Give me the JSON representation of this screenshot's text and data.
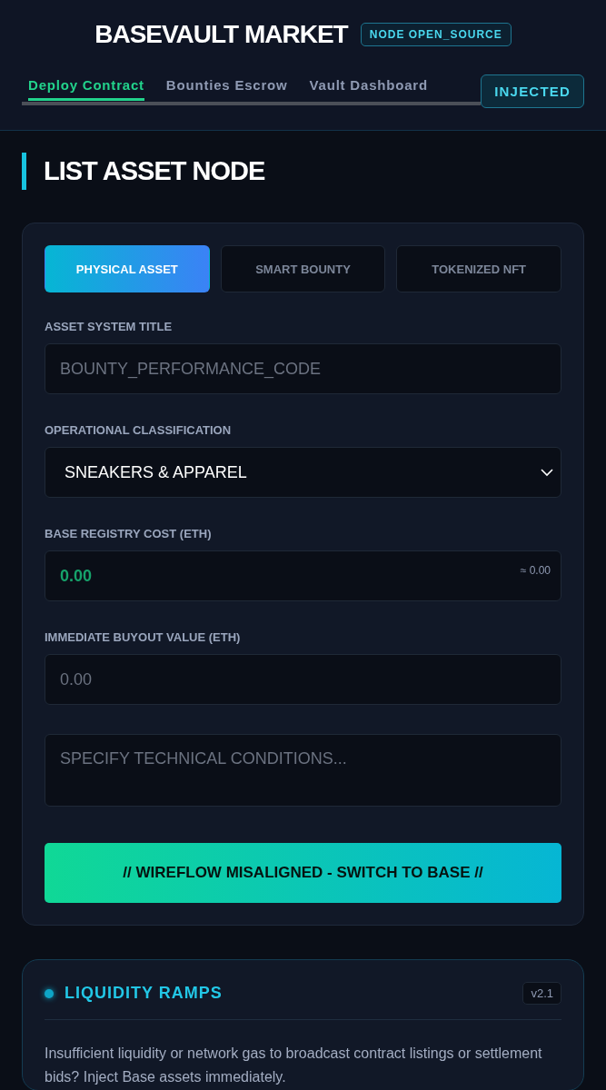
{
  "header": {
    "title": "BASEVAULT MARKET",
    "badge": "NODE OPEN_SOURCE"
  },
  "nav": {
    "tabs": [
      {
        "label": "Deploy Contract",
        "selected": true
      },
      {
        "label": "Bounties Escrow",
        "selected": false
      },
      {
        "label": "Vault Dashboard",
        "selected": false
      }
    ],
    "status_button": "INJECTED"
  },
  "section_title": "LIST ASSET NODE",
  "form": {
    "asset_types": [
      {
        "label": "PHYSICAL ASSET",
        "selected": true
      },
      {
        "label": "SMART BOUNTY",
        "selected": false
      },
      {
        "label": "TOKENIZED NFT",
        "selected": false
      }
    ],
    "fields": [
      {
        "kind": "text",
        "label": "ASSET SYSTEM TITLE",
        "placeholder": "BOUNTY_PERFORMANCE_CODE"
      },
      {
        "kind": "select",
        "label": "OPERATIONAL CLASSIFICATION",
        "value": "SNEAKERS & APPAREL"
      },
      {
        "kind": "price",
        "label": "BASE REGISTRY COST (ETH)",
        "value": "0.00",
        "hint": "≈ 0.00"
      },
      {
        "kind": "text",
        "label": "IMMEDIATE BUYOUT VALUE (ETH)",
        "placeholder": "0.00"
      },
      {
        "kind": "textarea",
        "placeholder": "SPECIFY TECHNICAL CONDITIONS..."
      }
    ],
    "submit": "// WIREFLOW MISALIGNED - SWITCH TO BASE //"
  },
  "liquidity": {
    "title": "LIQUIDITY RAMPS",
    "version": "v2.1",
    "text": "Insufficient liquidity or network gas to broadcast contract listings or settlement bids? Inject Base assets immediately."
  }
}
